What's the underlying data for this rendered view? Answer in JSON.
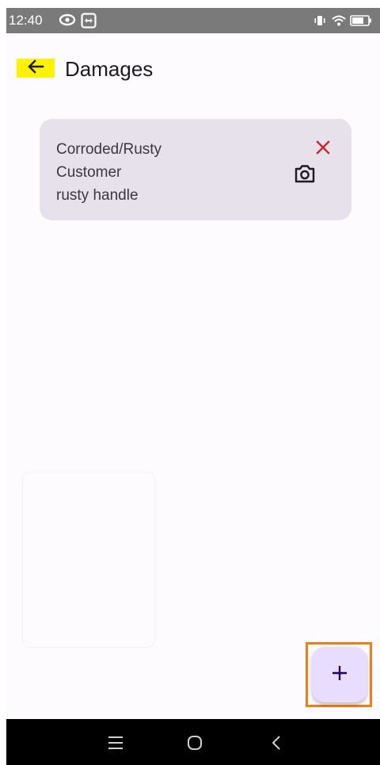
{
  "status_bar": {
    "time": "12:40",
    "left_icons": [
      "eye-icon",
      "teamviewer-icon"
    ],
    "right_icons": [
      "vibrate-icon",
      "wifi-icon",
      "battery-icon"
    ]
  },
  "app_bar": {
    "back_icon": "arrow-left-icon",
    "title": "Damages"
  },
  "damages": [
    {
      "type": "Corroded/Rusty",
      "reported_by": "Customer",
      "description": "rusty handle",
      "delete_icon": "close-icon",
      "photo_icon": "camera-icon"
    }
  ],
  "fab": {
    "icon": "plus-icon",
    "label": "+"
  },
  "navigation": {
    "buttons": [
      "menu-icon",
      "home-icon",
      "back-icon"
    ]
  },
  "colors": {
    "background": "#fefbff",
    "card": "#e6e1ea",
    "delete": "#c62828",
    "fab": "#e9ddff",
    "highlight_back": "#fff200",
    "highlight_fab": "#ef7d1a"
  }
}
